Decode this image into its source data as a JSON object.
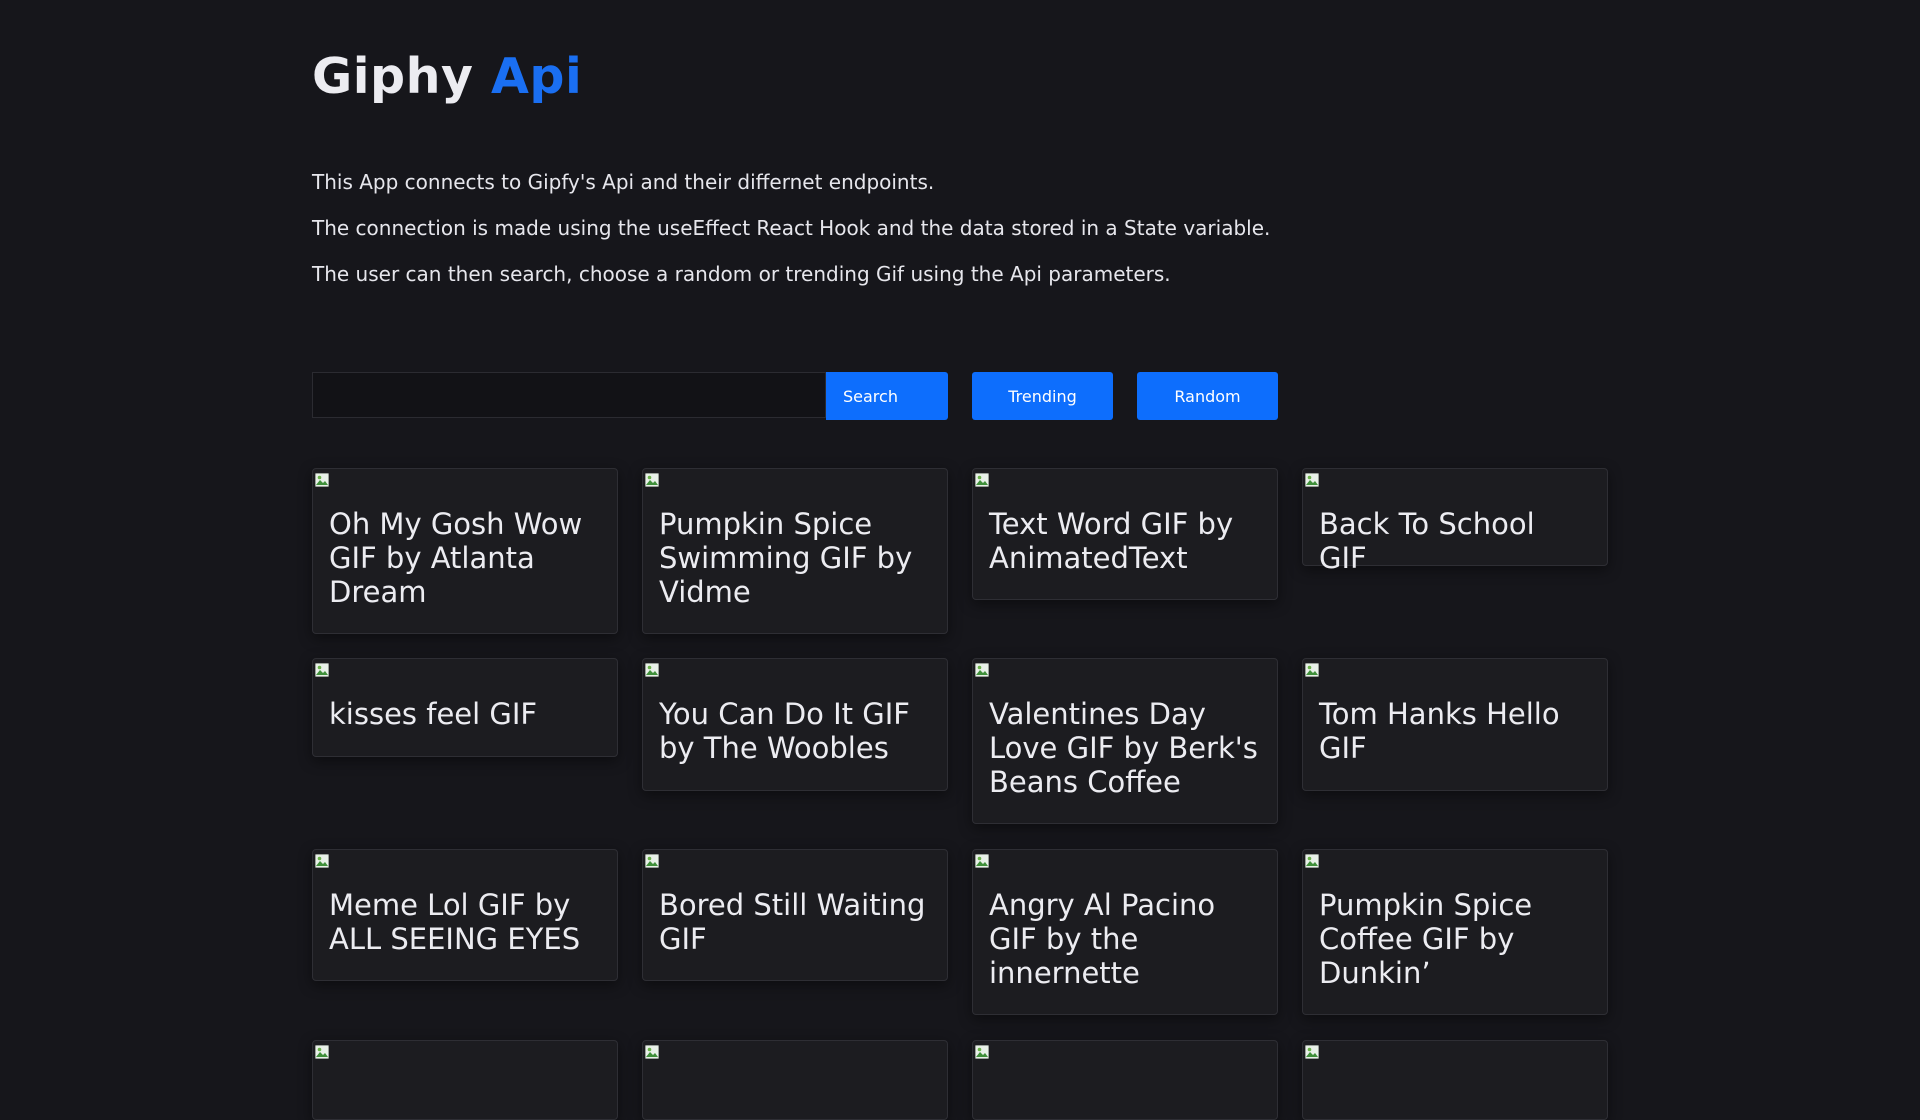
{
  "header": {
    "title_main": "Giphy",
    "title_accent": "Api"
  },
  "intro": [
    "This App connects to Gipfy's Api and their differnet endpoints.",
    "The connection is made using the useEffect React Hook and the data stored in a State variable.",
    "The user can then search, choose a random or trending Gif using the Api parameters."
  ],
  "controls": {
    "search_value": "",
    "search_placeholder": "",
    "search_label": "Search",
    "trending_label": "Trending",
    "random_label": "Random"
  },
  "colors": {
    "background": "#16161b",
    "accent": "#1a6ff2",
    "button": "#0d6efd",
    "card": "#1c1c20"
  },
  "gifs": [
    {
      "title": "Oh My Gosh Wow GIF by Atlanta Dream",
      "icon": "broken-image-icon"
    },
    {
      "title": "Pumpkin Spice Swimming GIF by Vidme",
      "icon": "broken-image-icon"
    },
    {
      "title": "Text Word GIF by AnimatedText",
      "icon": "broken-image-icon"
    },
    {
      "title": "Back To School GIF",
      "icon": "broken-image-icon"
    },
    {
      "title": "kisses feel GIF",
      "icon": "broken-image-icon"
    },
    {
      "title": "You Can Do It GIF by The Woobles",
      "icon": "broken-image-icon"
    },
    {
      "title": "Valentines Day Love GIF by Berk's Beans Coffee",
      "icon": "broken-image-icon"
    },
    {
      "title": "Tom Hanks Hello GIF",
      "icon": "broken-image-icon"
    },
    {
      "title": "Meme Lol GIF by ALL SEEING EYES",
      "icon": "broken-image-icon"
    },
    {
      "title": "Bored Still Waiting GIF",
      "icon": "broken-image-icon"
    },
    {
      "title": "Angry Al Pacino GIF by the innernette",
      "icon": "broken-image-icon"
    },
    {
      "title": "Pumpkin Spice Coffee GIF by Dunkin’",
      "icon": "broken-image-icon"
    },
    {
      "title": "",
      "icon": "broken-image-icon"
    },
    {
      "title": "",
      "icon": "broken-image-icon"
    },
    {
      "title": "",
      "icon": "broken-image-icon"
    },
    {
      "title": "",
      "icon": "broken-image-icon"
    }
  ]
}
